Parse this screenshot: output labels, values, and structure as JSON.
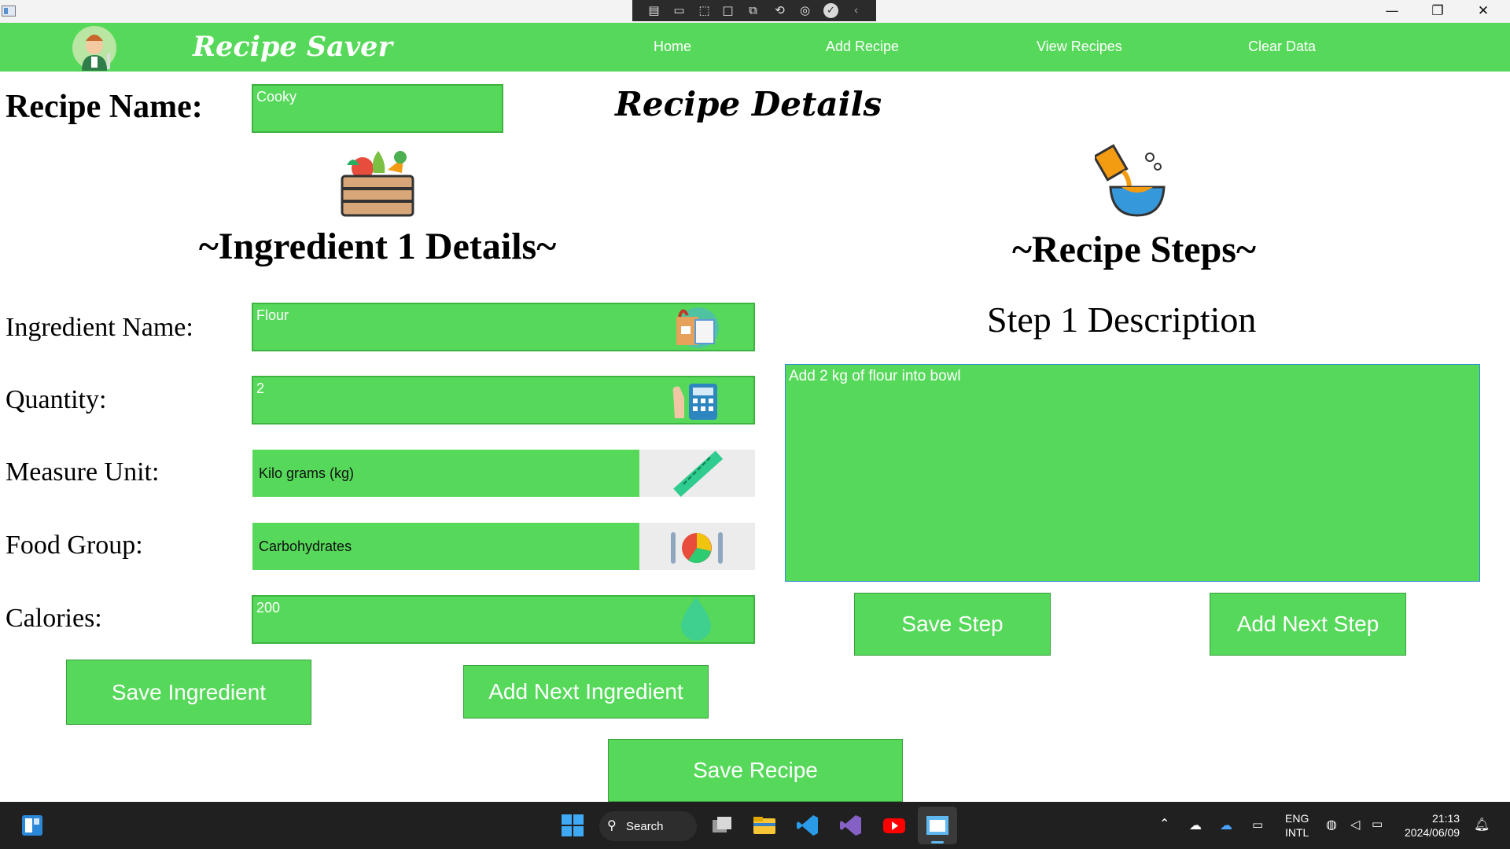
{
  "window": {
    "minimize_glyph": "—",
    "restore_glyph": "❐",
    "close_glyph": "✕"
  },
  "navbar": {
    "brand": "Recipe Saver",
    "links": [
      "Home",
      "Add Recipe",
      "View Recipes",
      "Clear Data"
    ]
  },
  "recipe": {
    "name_label": "Recipe Name:",
    "name_value": "Cooky",
    "details_title": "Recipe Details"
  },
  "ingredient": {
    "title": "~Ingredient 1 Details~",
    "name_label": "Ingredient Name:",
    "name_value": "Flour",
    "quantity_label": "Quantity:",
    "quantity_value": "2",
    "unit_label": "Measure Unit:",
    "unit_value": "Kilo grams (kg)",
    "group_label": "Food Group:",
    "group_value": "Carbohydrates",
    "calories_label": "Calories:",
    "calories_value": "200",
    "save_button": "Save Ingredient",
    "next_button": "Add Next Ingredient"
  },
  "steps": {
    "title": "~Recipe Steps~",
    "step_label": "Step 1 Description",
    "step_value": "Add 2 kg of flour into bowl",
    "save_button": "Save Step",
    "next_button": "Add Next Step"
  },
  "save_recipe_button": "Save Recipe",
  "taskbar": {
    "search_label": "Search",
    "lang_top": "ENG",
    "lang_bottom": "INTL",
    "time": "21:13",
    "date": "2024/06/09"
  },
  "colors": {
    "accent": "#56d95a",
    "taskbar": "#202020"
  }
}
